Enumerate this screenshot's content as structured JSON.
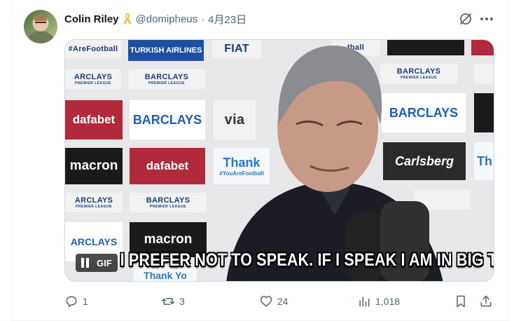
{
  "tweet": {
    "author_name": "Colin Riley",
    "handle": "@domipheus",
    "separator": "·",
    "date": "4月23日",
    "ribbon_color": "#f6c342"
  },
  "media": {
    "type": "GIF",
    "gif_label": "GIF",
    "caption": "I PREFER NOT TO SPEAK. IF I SPEAK I AM IN BIG TROUBLE.",
    "board": {
      "barclays": "BARCLAYS",
      "premier_league": "PREMIER LEAGUE",
      "dafabet": "dafabet",
      "macron": "macron",
      "carlsberg": "Carlsberg",
      "turkish": "TURKISH AIRLINES",
      "thank": "Thank",
      "thank_tag": "#YouAreFootball",
      "fiat": "FIAT",
      "via": "via",
      "afootball": "#AreFootball",
      "tball": "tball",
      "ifafe": "dafabet",
      "aclays": "ARCLAYS",
      "thank_you": "Thank Yo",
      "th": "Th"
    }
  },
  "actions": {
    "replies": "1",
    "reposts": "3",
    "likes": "24",
    "views": "1,018"
  }
}
